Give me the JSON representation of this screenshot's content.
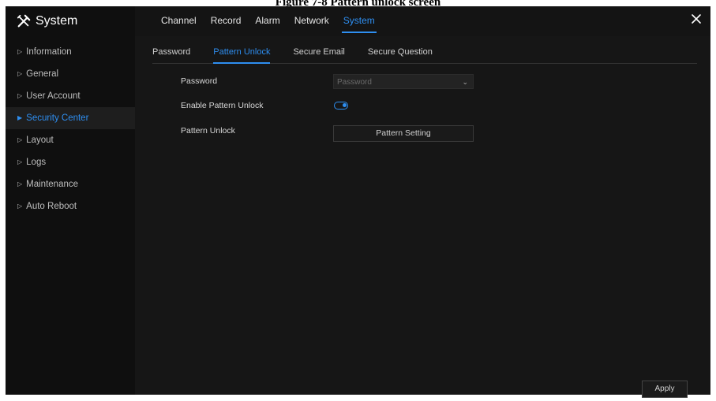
{
  "caption": "Figure 7-8 Pattern unlock screen",
  "app": {
    "title": "System",
    "icon": "tools-icon"
  },
  "topnav": [
    {
      "label": "Channel",
      "active": false
    },
    {
      "label": "Record",
      "active": false
    },
    {
      "label": "Alarm",
      "active": false
    },
    {
      "label": "Network",
      "active": false
    },
    {
      "label": "System",
      "active": true
    }
  ],
  "close_icon": "close-icon",
  "sidebar": {
    "items": [
      {
        "label": "Information"
      },
      {
        "label": "General"
      },
      {
        "label": "User Account"
      },
      {
        "label": "Security Center",
        "active": true
      },
      {
        "label": "Layout"
      },
      {
        "label": "Logs"
      },
      {
        "label": "Maintenance"
      },
      {
        "label": "Auto Reboot"
      }
    ]
  },
  "subtabs": [
    {
      "label": "Password"
    },
    {
      "label": "Pattern Unlock",
      "active": true
    },
    {
      "label": "Secure Email"
    },
    {
      "label": "Secure Question"
    }
  ],
  "form": {
    "password_label": "Password",
    "password_select_value": "Password",
    "enable_pattern_label": "Enable Pattern Unlock",
    "enable_pattern_on": true,
    "pattern_unlock_label": "Pattern Unlock",
    "pattern_setting_button": "Pattern Setting"
  },
  "apply_button": "Apply",
  "colors": {
    "accent": "#2e8ef0",
    "background": "#141414"
  }
}
